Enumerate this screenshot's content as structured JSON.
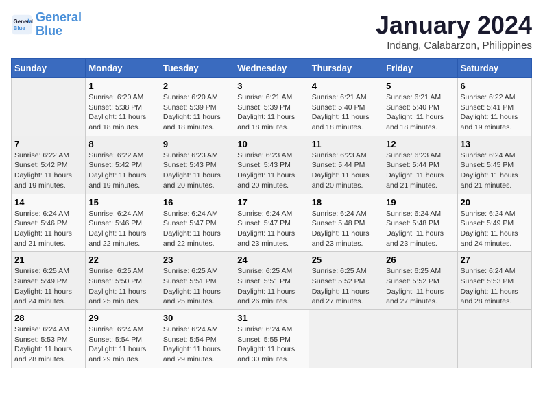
{
  "header": {
    "logo_line1": "General",
    "logo_line2": "Blue",
    "title": "January 2024",
    "subtitle": "Indang, Calabarzon, Philippines"
  },
  "calendar": {
    "headers": [
      "Sunday",
      "Monday",
      "Tuesday",
      "Wednesday",
      "Thursday",
      "Friday",
      "Saturday"
    ],
    "rows": [
      [
        {
          "num": "",
          "detail": ""
        },
        {
          "num": "1",
          "detail": "Sunrise: 6:20 AM\nSunset: 5:38 PM\nDaylight: 11 hours\nand 18 minutes."
        },
        {
          "num": "2",
          "detail": "Sunrise: 6:20 AM\nSunset: 5:39 PM\nDaylight: 11 hours\nand 18 minutes."
        },
        {
          "num": "3",
          "detail": "Sunrise: 6:21 AM\nSunset: 5:39 PM\nDaylight: 11 hours\nand 18 minutes."
        },
        {
          "num": "4",
          "detail": "Sunrise: 6:21 AM\nSunset: 5:40 PM\nDaylight: 11 hours\nand 18 minutes."
        },
        {
          "num": "5",
          "detail": "Sunrise: 6:21 AM\nSunset: 5:40 PM\nDaylight: 11 hours\nand 18 minutes."
        },
        {
          "num": "6",
          "detail": "Sunrise: 6:22 AM\nSunset: 5:41 PM\nDaylight: 11 hours\nand 19 minutes."
        }
      ],
      [
        {
          "num": "7",
          "detail": "Sunrise: 6:22 AM\nSunset: 5:42 PM\nDaylight: 11 hours\nand 19 minutes."
        },
        {
          "num": "8",
          "detail": "Sunrise: 6:22 AM\nSunset: 5:42 PM\nDaylight: 11 hours\nand 19 minutes."
        },
        {
          "num": "9",
          "detail": "Sunrise: 6:23 AM\nSunset: 5:43 PM\nDaylight: 11 hours\nand 20 minutes."
        },
        {
          "num": "10",
          "detail": "Sunrise: 6:23 AM\nSunset: 5:43 PM\nDaylight: 11 hours\nand 20 minutes."
        },
        {
          "num": "11",
          "detail": "Sunrise: 6:23 AM\nSunset: 5:44 PM\nDaylight: 11 hours\nand 20 minutes."
        },
        {
          "num": "12",
          "detail": "Sunrise: 6:23 AM\nSunset: 5:44 PM\nDaylight: 11 hours\nand 21 minutes."
        },
        {
          "num": "13",
          "detail": "Sunrise: 6:24 AM\nSunset: 5:45 PM\nDaylight: 11 hours\nand 21 minutes."
        }
      ],
      [
        {
          "num": "14",
          "detail": "Sunrise: 6:24 AM\nSunset: 5:46 PM\nDaylight: 11 hours\nand 21 minutes."
        },
        {
          "num": "15",
          "detail": "Sunrise: 6:24 AM\nSunset: 5:46 PM\nDaylight: 11 hours\nand 22 minutes."
        },
        {
          "num": "16",
          "detail": "Sunrise: 6:24 AM\nSunset: 5:47 PM\nDaylight: 11 hours\nand 22 minutes."
        },
        {
          "num": "17",
          "detail": "Sunrise: 6:24 AM\nSunset: 5:47 PM\nDaylight: 11 hours\nand 23 minutes."
        },
        {
          "num": "18",
          "detail": "Sunrise: 6:24 AM\nSunset: 5:48 PM\nDaylight: 11 hours\nand 23 minutes."
        },
        {
          "num": "19",
          "detail": "Sunrise: 6:24 AM\nSunset: 5:48 PM\nDaylight: 11 hours\nand 23 minutes."
        },
        {
          "num": "20",
          "detail": "Sunrise: 6:24 AM\nSunset: 5:49 PM\nDaylight: 11 hours\nand 24 minutes."
        }
      ],
      [
        {
          "num": "21",
          "detail": "Sunrise: 6:25 AM\nSunset: 5:49 PM\nDaylight: 11 hours\nand 24 minutes."
        },
        {
          "num": "22",
          "detail": "Sunrise: 6:25 AM\nSunset: 5:50 PM\nDaylight: 11 hours\nand 25 minutes."
        },
        {
          "num": "23",
          "detail": "Sunrise: 6:25 AM\nSunset: 5:51 PM\nDaylight: 11 hours\nand 25 minutes."
        },
        {
          "num": "24",
          "detail": "Sunrise: 6:25 AM\nSunset: 5:51 PM\nDaylight: 11 hours\nand 26 minutes."
        },
        {
          "num": "25",
          "detail": "Sunrise: 6:25 AM\nSunset: 5:52 PM\nDaylight: 11 hours\nand 27 minutes."
        },
        {
          "num": "26",
          "detail": "Sunrise: 6:25 AM\nSunset: 5:52 PM\nDaylight: 11 hours\nand 27 minutes."
        },
        {
          "num": "27",
          "detail": "Sunrise: 6:24 AM\nSunset: 5:53 PM\nDaylight: 11 hours\nand 28 minutes."
        }
      ],
      [
        {
          "num": "28",
          "detail": "Sunrise: 6:24 AM\nSunset: 5:53 PM\nDaylight: 11 hours\nand 28 minutes."
        },
        {
          "num": "29",
          "detail": "Sunrise: 6:24 AM\nSunset: 5:54 PM\nDaylight: 11 hours\nand 29 minutes."
        },
        {
          "num": "30",
          "detail": "Sunrise: 6:24 AM\nSunset: 5:54 PM\nDaylight: 11 hours\nand 29 minutes."
        },
        {
          "num": "31",
          "detail": "Sunrise: 6:24 AM\nSunset: 5:55 PM\nDaylight: 11 hours\nand 30 minutes."
        },
        {
          "num": "",
          "detail": ""
        },
        {
          "num": "",
          "detail": ""
        },
        {
          "num": "",
          "detail": ""
        }
      ]
    ]
  }
}
